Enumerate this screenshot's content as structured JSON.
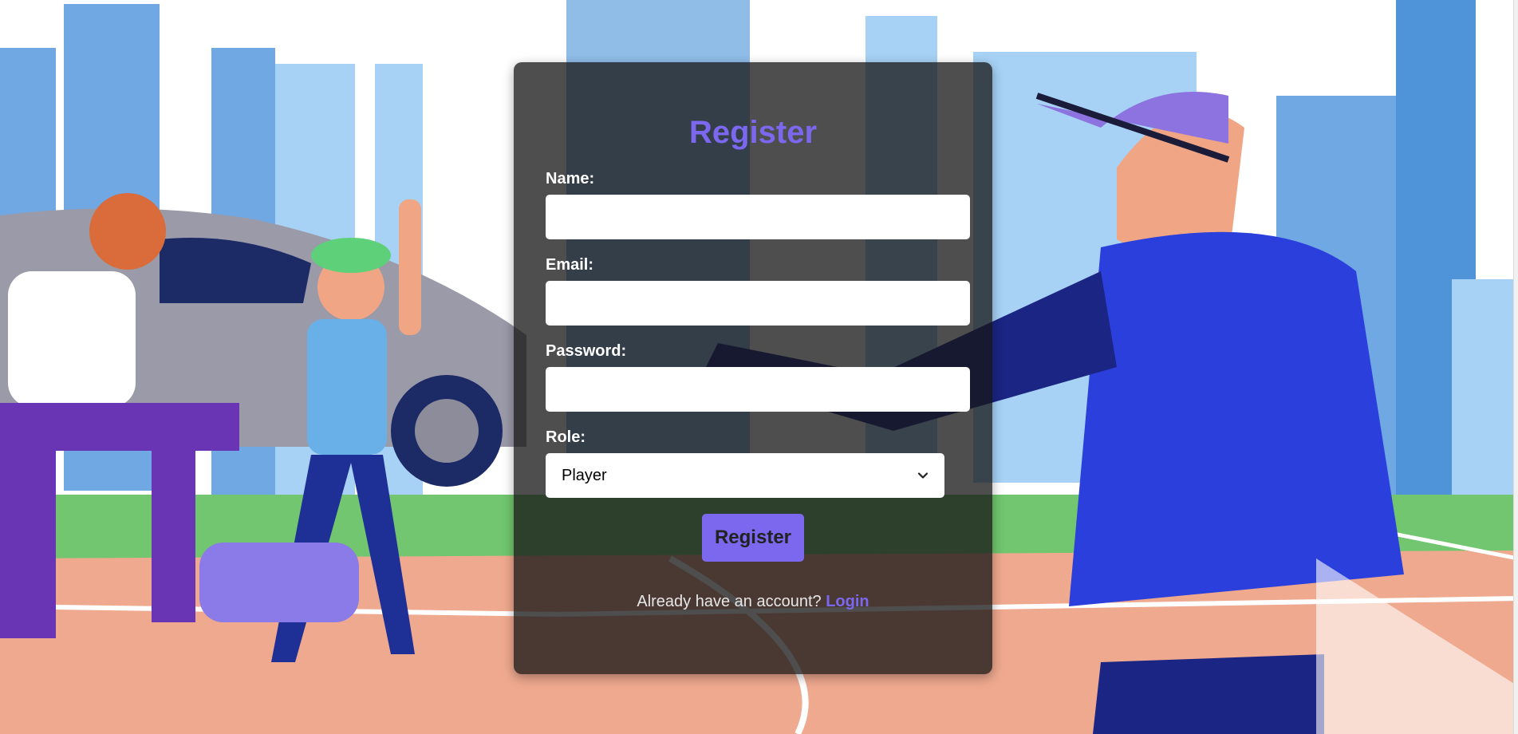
{
  "colors": {
    "accent": "#7b68ee",
    "card_background": "rgba(22,22,22,0.76)",
    "label_text": "#ffffff",
    "footer_text": "#e6e6e6"
  },
  "background": {
    "icon": "baseball-illustration"
  },
  "register_form": {
    "title": "Register",
    "fields": {
      "name": {
        "label": "Name:",
        "value": ""
      },
      "email": {
        "label": "Email:",
        "value": ""
      },
      "password": {
        "label": "Password:",
        "value": ""
      },
      "role": {
        "label": "Role:",
        "selected": "Player",
        "icon": "chevron-down-icon"
      }
    },
    "submit_label": "Register",
    "footer": {
      "prompt": "Already have an account? ",
      "login_link": "Login"
    }
  }
}
